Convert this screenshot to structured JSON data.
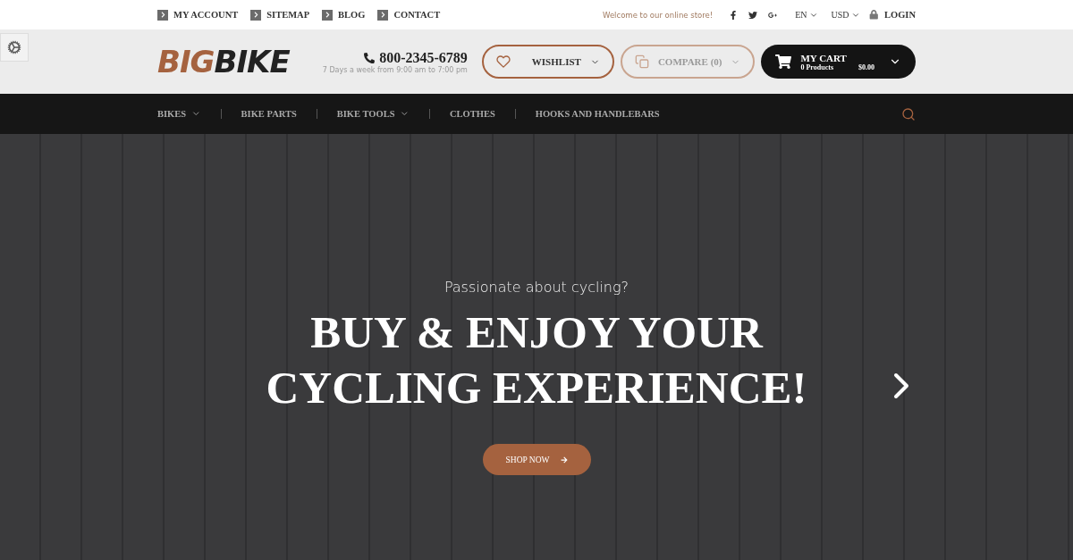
{
  "top_links": [
    "MY ACCOUNT",
    "SITEMAP",
    "BLOG",
    "CONTACT"
  ],
  "welcome": "Welcome to our online store!",
  "social": [
    {
      "kind": "facebook"
    },
    {
      "kind": "twitter"
    },
    {
      "kind": "googleplus"
    }
  ],
  "language": "EN",
  "currency": "USD",
  "login": "LOGIN",
  "logo": {
    "part_1": "BIG",
    "part_2": "BIKE"
  },
  "phone": {
    "number": "800-2345-6789",
    "hours": "7 Days a week from 9:00 am to 7:00 pm"
  },
  "wishlist": "WISHLIST",
  "compare": "COMPARE (0)",
  "cart": {
    "title": "MY CART",
    "products": "0 Products",
    "total": "$0.00"
  },
  "nav": [
    {
      "label": "BIKES",
      "dropdown": true
    },
    {
      "label": "BIKE PARTS",
      "dropdown": false
    },
    {
      "label": "BIKE TOOLS",
      "dropdown": true
    },
    {
      "label": "CLOTHES",
      "dropdown": false
    },
    {
      "label": "HOOKS AND HANDLEBARS",
      "dropdown": false
    }
  ],
  "hero": {
    "tagline": "Passionate about cycling?",
    "headline_1": "BUY & ENJOY YOUR",
    "headline_2": "CYCLING EXPERIENCE!",
    "button": "SHOP NOW"
  }
}
